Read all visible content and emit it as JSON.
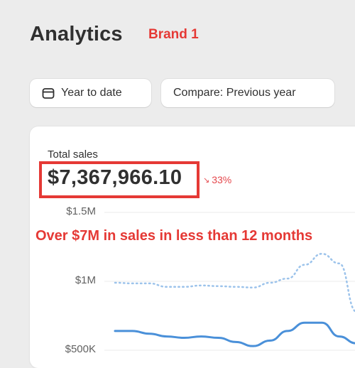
{
  "header": {
    "title": "Analytics",
    "brand_label": "Brand 1"
  },
  "filters": {
    "date_range_label": "Year to date",
    "compare_label": "Compare: Previous year"
  },
  "metric": {
    "label": "Total sales",
    "value": "$7,367,966.10",
    "change": "33%",
    "change_direction": "down"
  },
  "annotation": "Over $7M in sales in less than 12 months",
  "colors": {
    "accent_red": "#e53935",
    "current_line": "#4a90d9",
    "previous_line": "#9cc3eb"
  },
  "icons": {
    "date_range": "calendar-icon",
    "change": "arrow-down-right-icon"
  },
  "chart_data": {
    "type": "line",
    "y_ticks": [
      "$1.5M",
      "$1M",
      "$500K"
    ],
    "ylim": [
      500000,
      1500000
    ],
    "series": [
      {
        "line_style": "solid",
        "values": [
          640000,
          640000,
          620000,
          600000,
          590000,
          600000,
          590000,
          560000,
          530000,
          570000,
          640000,
          700000,
          700000,
          600000,
          550000
        ]
      },
      {
        "line_style": "dotted",
        "values": [
          990000,
          985000,
          985000,
          960000,
          960000,
          970000,
          965000,
          960000,
          955000,
          990000,
          1020000,
          1120000,
          1200000,
          1130000,
          780000
        ]
      }
    ]
  }
}
